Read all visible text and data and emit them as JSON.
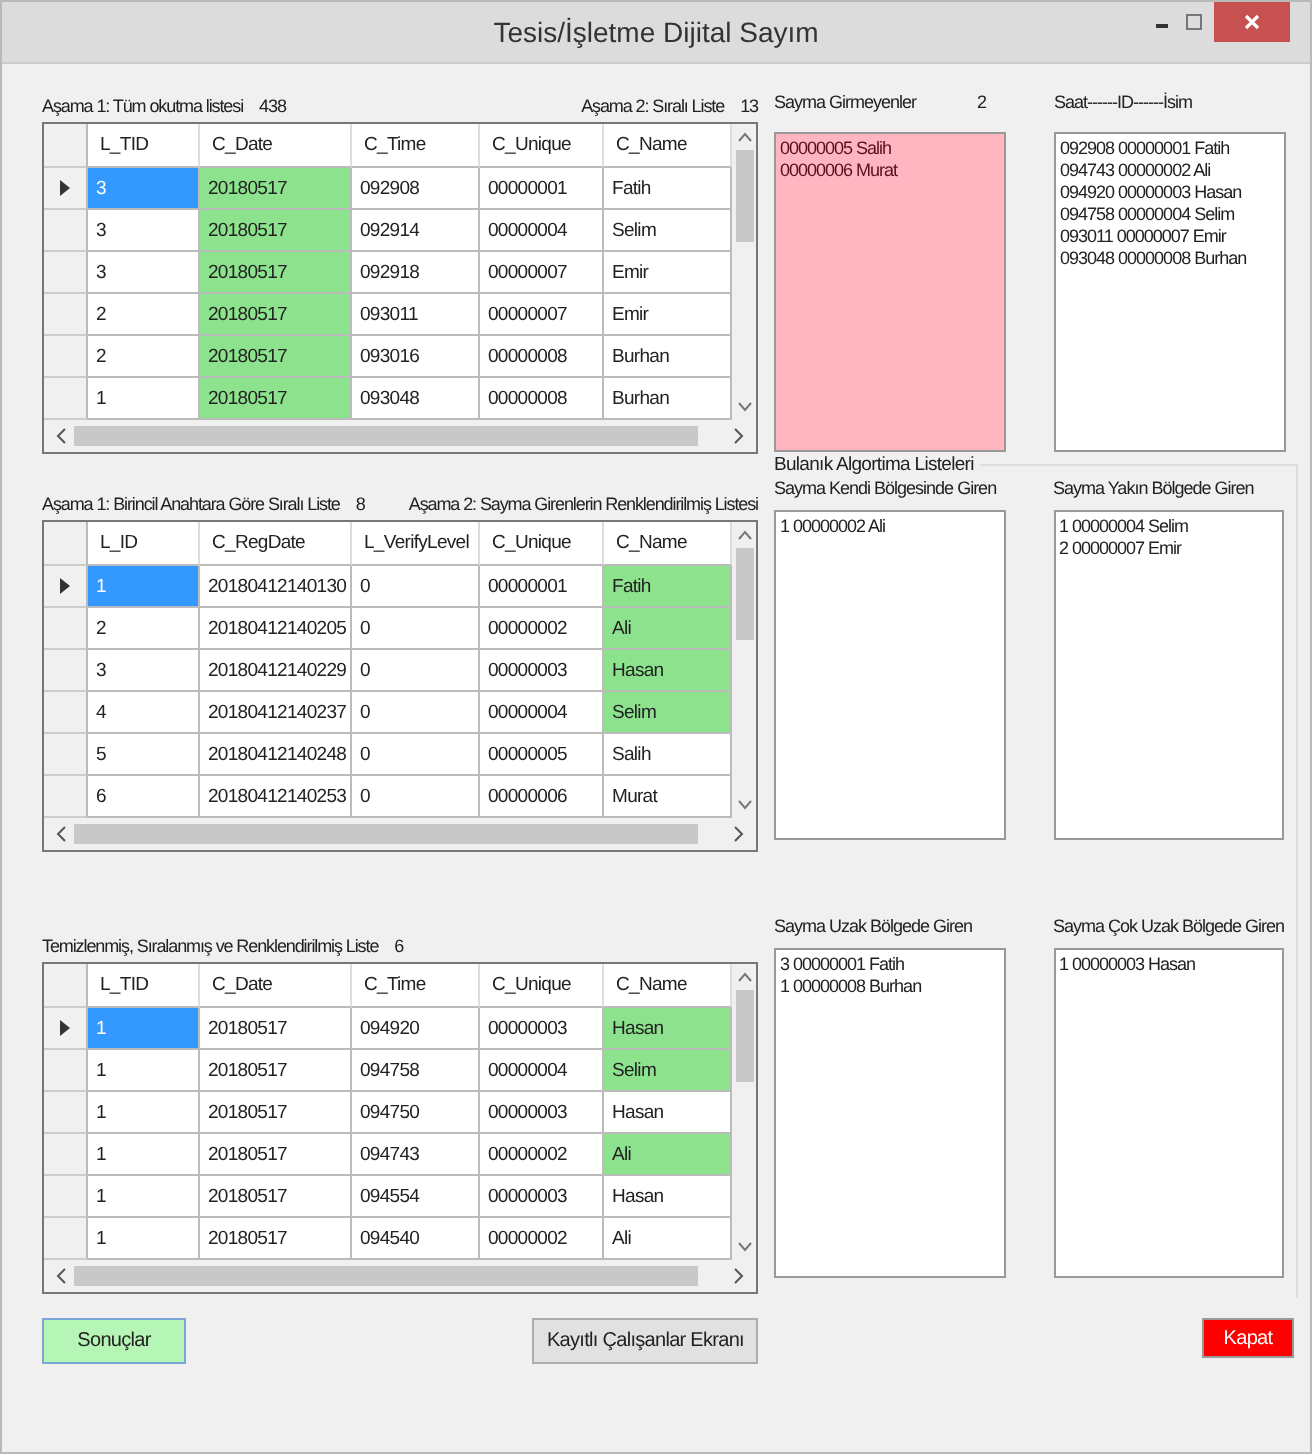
{
  "window": {
    "title": "Tesis/İşletme Dijital Sayım"
  },
  "grids": [
    {
      "label": "Aşama 1: Tüm okutma listesi",
      "count": "438",
      "side_label": "Aşama 2: Sıralı Liste",
      "side_count": "13",
      "columns": [
        "L_TID",
        "C_Date",
        "C_Time",
        "C_Unique",
        "C_Name"
      ],
      "rows": [
        {
          "selected": true,
          "cells": [
            {
              "text": "3",
              "highlighted": false
            },
            {
              "text": "20180517",
              "highlighted": true
            },
            {
              "text": "092908",
              "highlighted": false
            },
            {
              "text": "00000001",
              "highlighted": false
            },
            {
              "text": "Fatih",
              "highlighted": false
            }
          ]
        },
        {
          "selected": false,
          "cells": [
            {
              "text": "3",
              "highlighted": false
            },
            {
              "text": "20180517",
              "highlighted": true
            },
            {
              "text": "092914",
              "highlighted": false
            },
            {
              "text": "00000004",
              "highlighted": false
            },
            {
              "text": "Selim",
              "highlighted": false
            }
          ]
        },
        {
          "selected": false,
          "cells": [
            {
              "text": "3",
              "highlighted": false
            },
            {
              "text": "20180517",
              "highlighted": true
            },
            {
              "text": "092918",
              "highlighted": false
            },
            {
              "text": "00000007",
              "highlighted": false
            },
            {
              "text": "Emir",
              "highlighted": false
            }
          ]
        },
        {
          "selected": false,
          "cells": [
            {
              "text": "2",
              "highlighted": false
            },
            {
              "text": "20180517",
              "highlighted": true
            },
            {
              "text": "093011",
              "highlighted": false
            },
            {
              "text": "00000007",
              "highlighted": false
            },
            {
              "text": "Emir",
              "highlighted": false
            }
          ]
        },
        {
          "selected": false,
          "cells": [
            {
              "text": "2",
              "highlighted": false
            },
            {
              "text": "20180517",
              "highlighted": true
            },
            {
              "text": "093016",
              "highlighted": false
            },
            {
              "text": "00000008",
              "highlighted": false
            },
            {
              "text": "Burhan",
              "highlighted": false
            }
          ]
        },
        {
          "selected": false,
          "cells": [
            {
              "text": "1",
              "highlighted": false
            },
            {
              "text": "20180517",
              "highlighted": true
            },
            {
              "text": "093048",
              "highlighted": false
            },
            {
              "text": "00000008",
              "highlighted": false
            },
            {
              "text": "Burhan",
              "highlighted": false
            }
          ]
        }
      ]
    },
    {
      "label": "Aşama 1: Birincil Anahtara Göre Sıralı Liste",
      "count": "8",
      "side_label": "Aşama 2: Sayma Girenlerin Renklendirilmiş Listesi",
      "columns": [
        "L_ID",
        "C_RegDate",
        "L_VerifyLevel",
        "C_Unique",
        "C_Name"
      ],
      "rows": [
        {
          "selected": true,
          "cells": [
            {
              "text": "1",
              "highlighted": false
            },
            {
              "text": "20180412140130",
              "highlighted": false
            },
            {
              "text": "0",
              "highlighted": false
            },
            {
              "text": "00000001",
              "highlighted": false
            },
            {
              "text": "Fatih",
              "highlighted": true
            }
          ]
        },
        {
          "selected": false,
          "cells": [
            {
              "text": "2",
              "highlighted": false
            },
            {
              "text": "20180412140205",
              "highlighted": false
            },
            {
              "text": "0",
              "highlighted": false
            },
            {
              "text": "00000002",
              "highlighted": false
            },
            {
              "text": "Ali",
              "highlighted": true
            }
          ]
        },
        {
          "selected": false,
          "cells": [
            {
              "text": "3",
              "highlighted": false
            },
            {
              "text": "20180412140229",
              "highlighted": false
            },
            {
              "text": "0",
              "highlighted": false
            },
            {
              "text": "00000003",
              "highlighted": false
            },
            {
              "text": "Hasan",
              "highlighted": true
            }
          ]
        },
        {
          "selected": false,
          "cells": [
            {
              "text": "4",
              "highlighted": false
            },
            {
              "text": "20180412140237",
              "highlighted": false
            },
            {
              "text": "0",
              "highlighted": false
            },
            {
              "text": "00000004",
              "highlighted": false
            },
            {
              "text": "Selim",
              "highlighted": true
            }
          ]
        },
        {
          "selected": false,
          "cells": [
            {
              "text": "5",
              "highlighted": false
            },
            {
              "text": "20180412140248",
              "highlighted": false
            },
            {
              "text": "0",
              "highlighted": false
            },
            {
              "text": "00000005",
              "highlighted": false
            },
            {
              "text": "Salih",
              "highlighted": false
            }
          ]
        },
        {
          "selected": false,
          "cells": [
            {
              "text": "6",
              "highlighted": false
            },
            {
              "text": "20180412140253",
              "highlighted": false
            },
            {
              "text": "0",
              "highlighted": false
            },
            {
              "text": "00000006",
              "highlighted": false
            },
            {
              "text": "Murat",
              "highlighted": false
            }
          ]
        }
      ]
    },
    {
      "label": "Temizlenmiş, Sıralanmış ve Renklendirilmiş Liste",
      "count": "6",
      "columns": [
        "L_TID",
        "C_Date",
        "C_Time",
        "C_Unique",
        "C_Name"
      ],
      "rows": [
        {
          "selected": true,
          "cells": [
            {
              "text": "1",
              "highlighted": false
            },
            {
              "text": "20180517",
              "highlighted": false
            },
            {
              "text": "094920",
              "highlighted": false
            },
            {
              "text": "00000003",
              "highlighted": false
            },
            {
              "text": "Hasan",
              "highlighted": true
            }
          ]
        },
        {
          "selected": false,
          "cells": [
            {
              "text": "1",
              "highlighted": false
            },
            {
              "text": "20180517",
              "highlighted": false
            },
            {
              "text": "094758",
              "highlighted": false
            },
            {
              "text": "00000004",
              "highlighted": false
            },
            {
              "text": "Selim",
              "highlighted": true
            }
          ]
        },
        {
          "selected": false,
          "cells": [
            {
              "text": "1",
              "highlighted": false
            },
            {
              "text": "20180517",
              "highlighted": false
            },
            {
              "text": "094750",
              "highlighted": false
            },
            {
              "text": "00000003",
              "highlighted": false
            },
            {
              "text": "Hasan",
              "highlighted": false
            }
          ]
        },
        {
          "selected": false,
          "cells": [
            {
              "text": "1",
              "highlighted": false
            },
            {
              "text": "20180517",
              "highlighted": false
            },
            {
              "text": "094743",
              "highlighted": false
            },
            {
              "text": "00000002",
              "highlighted": false
            },
            {
              "text": "Ali",
              "highlighted": true
            }
          ]
        },
        {
          "selected": false,
          "cells": [
            {
              "text": "1",
              "highlighted": false
            },
            {
              "text": "20180517",
              "highlighted": false
            },
            {
              "text": "094554",
              "highlighted": false
            },
            {
              "text": "00000003",
              "highlighted": false
            },
            {
              "text": "Hasan",
              "highlighted": false
            }
          ]
        },
        {
          "selected": false,
          "cells": [
            {
              "text": "1",
              "highlighted": false
            },
            {
              "text": "20180517",
              "highlighted": false
            },
            {
              "text": "094540",
              "highlighted": false
            },
            {
              "text": "00000002",
              "highlighted": false
            },
            {
              "text": "Ali",
              "highlighted": false
            }
          ]
        }
      ]
    }
  ],
  "lists": [
    {
      "label": "Sayma Girmeyenler",
      "count": "2",
      "kind": "alert",
      "items": [
        "00000005 Salih",
        "00000006 Murat"
      ]
    },
    {
      "label": "Saat------ID------İsim",
      "kind": "plain",
      "items": [
        "092908 00000001 Fatih",
        "094743 00000002 Ali",
        "094920 00000003 Hasan",
        "094758 00000004 Selim",
        "093011 00000007 Emir",
        "093048 00000008 Burhan"
      ]
    }
  ],
  "fuzzy_group": {
    "title": "Bulanık Algortima Listeleri",
    "lists": [
      {
        "label": "Sayma Kendi Bölgesinde Giren",
        "items": [
          "1 00000002 Ali"
        ]
      },
      {
        "label": "Sayma Yakın Bölgede Giren",
        "items": [
          "1 00000004 Selim",
          "2 00000007 Emir"
        ]
      },
      {
        "label": "Sayma Uzak Bölgede Giren",
        "items": [
          "3 00000001 Fatih",
          "1 00000008 Burhan"
        ]
      },
      {
        "label": "Sayma Çok Uzak Bölgede Giren",
        "items": [
          "1 00000003 Hasan"
        ]
      }
    ]
  },
  "buttons": [
    {
      "label": "Sonuçlar",
      "kind": "success"
    },
    {
      "label": "Kayıtlı Çalışanlar Ekranı",
      "kind": "normal"
    },
    {
      "label": "Kapat",
      "kind": "danger"
    }
  ]
}
